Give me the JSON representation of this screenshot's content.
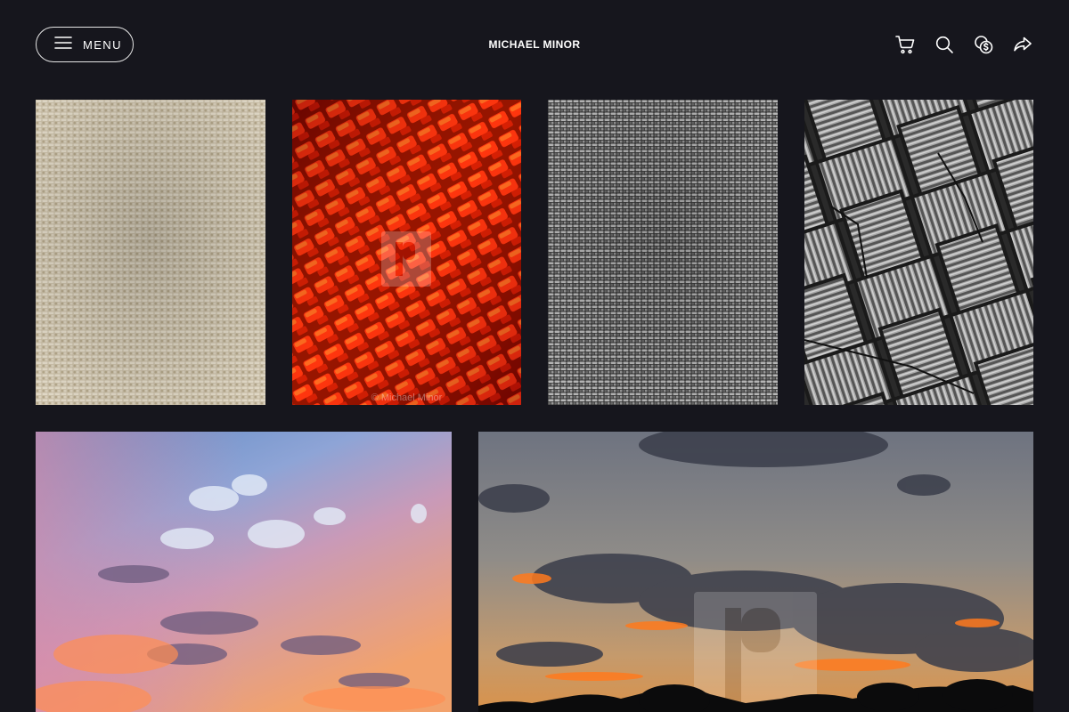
{
  "header": {
    "menu_label": "MENU",
    "site_title": "MICHAEL MINOR",
    "icons": [
      "cart-icon",
      "search-icon",
      "currency-icon",
      "share-icon"
    ]
  },
  "gallery": {
    "tiles": [
      {
        "subject": "beige woven fabric texture"
      },
      {
        "subject": "red woven texture",
        "watermark_caption": "© Michael Minor"
      },
      {
        "subject": "gray woven fabric texture"
      },
      {
        "subject": "gray cracked basket-weave texture"
      },
      {
        "subject": "pastel sunset sky with clouds"
      },
      {
        "subject": "dark orange sunset over tree line"
      }
    ]
  },
  "colors": {
    "background": "#16161d",
    "text": "#ffffff",
    "accent_red": "#e01b0e",
    "beige": "#cfc4ad"
  }
}
